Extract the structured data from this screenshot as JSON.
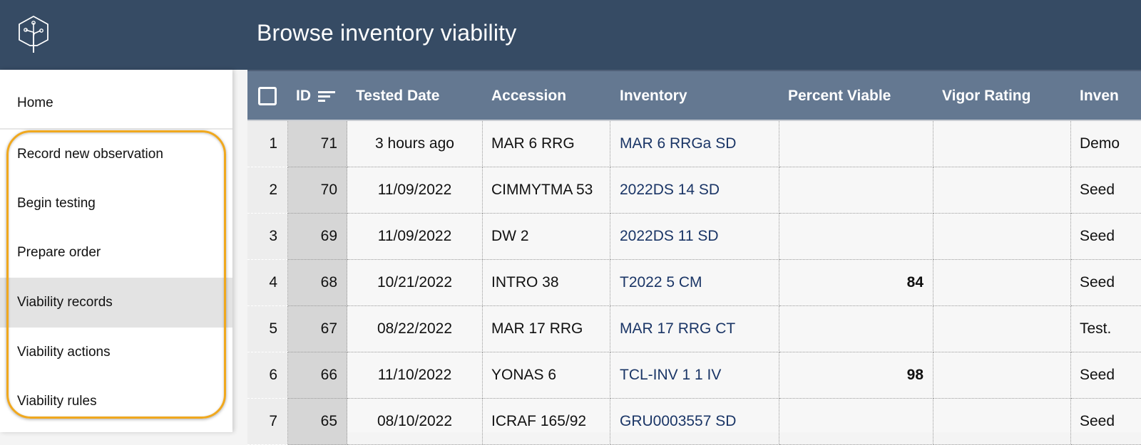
{
  "header": {
    "logo_icon": "tree-hexagon-logo-icon",
    "title": "Browse inventory viability"
  },
  "sidebar": {
    "items": [
      {
        "label": "Home",
        "active": false
      },
      {
        "label": "Record new observation",
        "active": false
      },
      {
        "label": "Begin testing",
        "active": false
      },
      {
        "label": "Prepare order",
        "active": false
      },
      {
        "label": "Viability records",
        "active": true
      },
      {
        "label": "Viability actions",
        "active": false
      },
      {
        "label": "Viability rules",
        "active": false
      }
    ],
    "highlight_color": "#f0a81e"
  },
  "grid": {
    "columns": [
      "ID",
      "Tested Date",
      "Accession",
      "Inventory",
      "Percent Viable",
      "Vigor Rating",
      "Inven"
    ],
    "sort_icon": "sort-descending-icon",
    "select_all_icon": "checkbox-icon",
    "rows": [
      {
        "num": "1",
        "id": "71",
        "date": "3 hours ago",
        "accession": "MAR 6 RRG",
        "inventory": "MAR 6 RRGa SD",
        "percent_viable": "",
        "vigor": "",
        "type": "Demo"
      },
      {
        "num": "2",
        "id": "70",
        "date": "11/09/2022",
        "accession": "CIMMYTMA 53",
        "inventory": "2022DS 14 SD",
        "percent_viable": "",
        "vigor": "",
        "type": "Seed"
      },
      {
        "num": "3",
        "id": "69",
        "date": "11/09/2022",
        "accession": "DW 2",
        "inventory": "2022DS 11 SD",
        "percent_viable": "",
        "vigor": "",
        "type": "Seed"
      },
      {
        "num": "4",
        "id": "68",
        "date": "10/21/2022",
        "accession": "INTRO 38",
        "inventory": "T2022 5 CM",
        "percent_viable": "84",
        "vigor": "",
        "type": "Seed"
      },
      {
        "num": "5",
        "id": "67",
        "date": "08/22/2022",
        "accession": "MAR 17 RRG",
        "inventory": "MAR 17 RRG CT",
        "percent_viable": "",
        "vigor": "",
        "type": "Test."
      },
      {
        "num": "6",
        "id": "66",
        "date": "11/10/2022",
        "accession": "YONAS 6",
        "inventory": "TCL-INV 1 1 IV",
        "percent_viable": "98",
        "vigor": "",
        "type": "Seed"
      },
      {
        "num": "7",
        "id": "65",
        "date": "08/10/2022",
        "accession": "ICRAF 165/92",
        "inventory": "GRU0003557 SD",
        "percent_viable": "",
        "vigor": "",
        "type": "Seed"
      }
    ]
  },
  "colors": {
    "topbar": "#364b64",
    "grid_header": "#647891",
    "link": "#1a3566",
    "active_nav": "#e3e3e3"
  }
}
